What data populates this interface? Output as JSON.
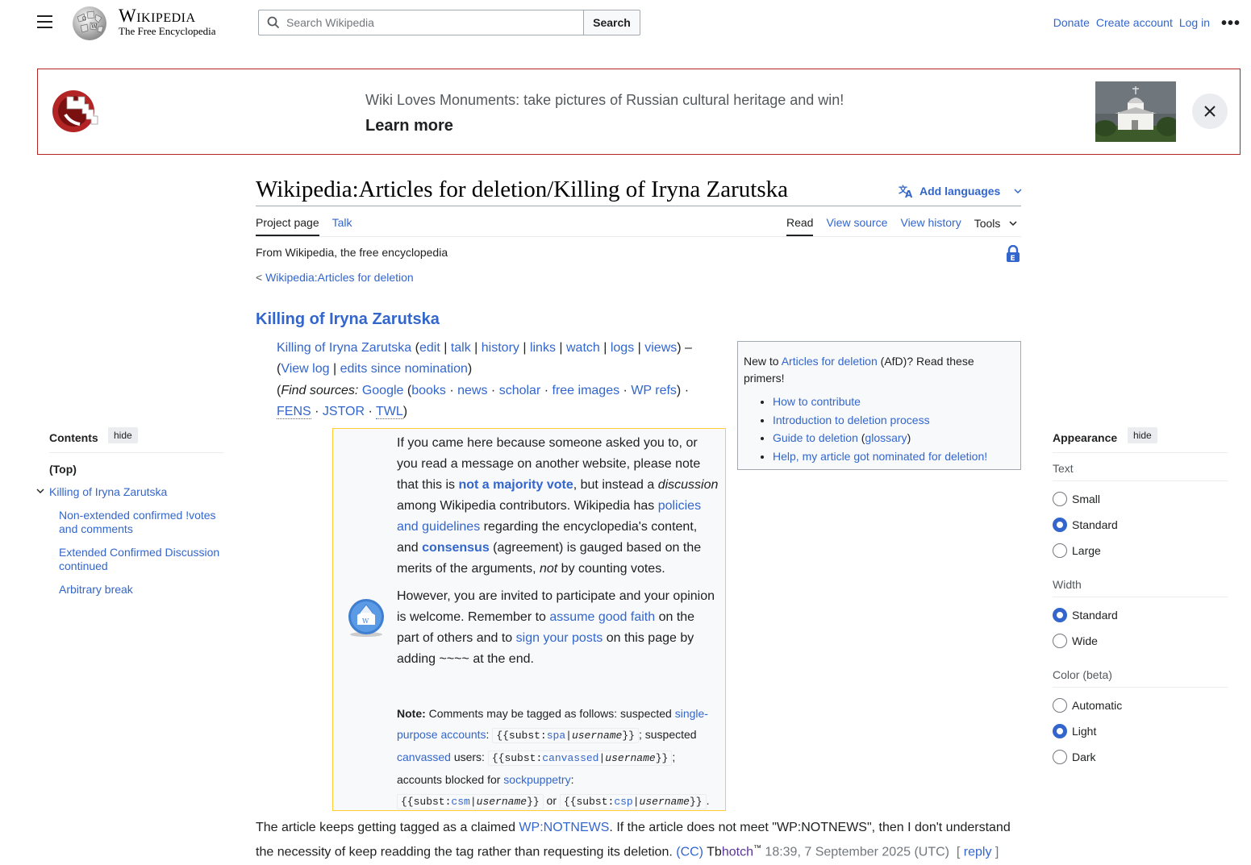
{
  "header": {
    "logo_title": "Wikipedia",
    "logo_tagline": "The Free Encyclopedia",
    "search_placeholder": "Search Wikipedia",
    "search_button": "Search",
    "donate": "Donate",
    "create_account": "Create account",
    "log_in": "Log in",
    "more": "•••"
  },
  "banner": {
    "text": "Wiki Loves Monuments: take pictures of Russian cultural heritage and win!",
    "learn_more": "Learn more"
  },
  "page": {
    "title": "Wikipedia:Articles for deletion/Killing of Iryna Zarutska",
    "add_languages": "Add languages",
    "tabs_left": [
      "Project page",
      "Talk"
    ],
    "tabs_right": [
      "Read",
      "View source",
      "View history",
      "Tools"
    ],
    "from": "From Wikipedia, the free encyclopedia",
    "breadcrumb_prefix": "<",
    "breadcrumb_link": "Wikipedia:Articles for deletion",
    "article_heading": "Killing of Iryna Zarutska"
  },
  "links": {
    "article": "Killing of Iryna Zarutska",
    "edit": "edit",
    "talk": "talk",
    "history": "history",
    "links": "links",
    "watch": "watch",
    "logs": "logs",
    "views": "views",
    "view_log": "View log",
    "edits_since": "edits since nomination",
    "find_sources": "Find sources:",
    "google": "Google",
    "books": "books",
    "news": "news",
    "scholar": "scholar",
    "free_images": "free images",
    "wp_refs": "WP refs",
    "fens": "FENS",
    "jstor": "JSTOR",
    "twl": "TWL"
  },
  "primer": {
    "intro_pre": "New to ",
    "intro_link": "Articles for deletion",
    "intro_post": " (AfD)? Read these primers!",
    "items": [
      "How to contribute",
      "Introduction to deletion process",
      "Guide to deletion",
      "Help, my article got nominated for deletion!"
    ],
    "glossary": "glossary"
  },
  "notice": {
    "p1_a": "If you came here because someone asked you to, or you read a message on another website, please note that this is ",
    "p1_link": "not a majority vote",
    "p1_b": ", but instead a ",
    "p1_em": "discussion",
    "p1_c": " among Wikipedia contributors. Wikipedia has ",
    "p1_link2": "policies and guidelines",
    "p1_d": " regarding the encyclopedia's content, and ",
    "p1_link3": "consensus",
    "p1_e": " (agreement) is gauged based on the merits of the arguments, ",
    "p1_em2": "not",
    "p1_f": " by counting votes.",
    "p2_a": "However, you are invited to participate and your opinion is welcome. Remember to ",
    "p2_link": "assume good faith",
    "p2_b": " on the part of others and to ",
    "p2_link2": "sign your posts",
    "p2_c": " on this page by adding ~~~~ at the end.",
    "note_label": "Note:",
    "note_a": " Comments may be tagged as follows: suspected ",
    "note_link1": "single-purpose accounts",
    "note_b": "; suspected ",
    "note_link2": "canvassed",
    "note_c": " users: ",
    "note_d": "; accounts blocked for ",
    "note_link3": "sockpuppetry",
    "note_e": " or ",
    "note_end": ".",
    "code_subst": "{{subst:",
    "code_spa": "spa",
    "code_canvassed": "canvassed",
    "code_csm": "csm",
    "code_csp": "csp",
    "code_pipe": "|",
    "code_username": "username",
    "code_close": "}}"
  },
  "comment": {
    "a": "The article keeps getting tagged as a claimed ",
    "link": "WP:NOTNEWS",
    "b": ". If the article does not meet \"WP:NOTNEWS\", then I don't understand the necessity of keep readding the tag rather than requesting its deletion. ",
    "cc": "(CC)",
    "user_a": "Tb",
    "user_b": "hotch",
    "tm": "™",
    "timestamp": " 18:39, 7 September 2025 (UTC)",
    "reply_open": "[",
    "reply": "reply",
    "reply_close": "]"
  },
  "toc": {
    "title": "Contents",
    "hide": "hide",
    "top": "(Top)",
    "items": [
      "Killing of Iryna Zarutska",
      "Non-extended confirmed !votes and comments",
      "Extended Confirmed Discussion continued",
      "Arbitrary break"
    ]
  },
  "appearance": {
    "title": "Appearance",
    "hide": "hide",
    "text_label": "Text",
    "text_options": [
      "Small",
      "Standard",
      "Large"
    ],
    "width_label": "Width",
    "width_options": [
      "Standard",
      "Wide"
    ],
    "color_label": "Color (beta)",
    "color_options": [
      "Automatic",
      "Light",
      "Dark"
    ]
  },
  "colors": {
    "link": "#3366cc",
    "banner_border": "#b32424",
    "notice_border": "#ffcc33"
  }
}
